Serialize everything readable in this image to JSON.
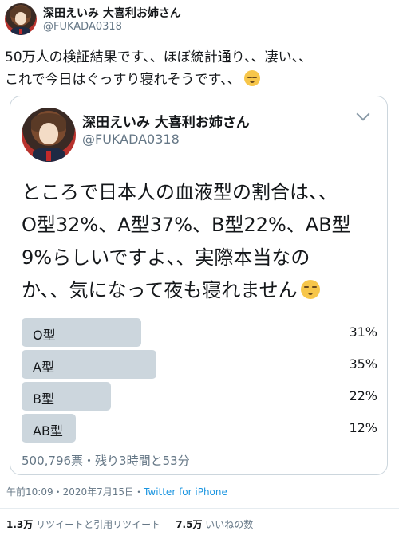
{
  "tweet": {
    "display_name": "深田えいみ 大喜利お姉さん",
    "handle": "@FUKADA0318",
    "text_line1": "50万人の検証結果です、、ほぼ統計通り、、凄い、、",
    "text_line2": "これで今日はぐっすり寝れそうです、、",
    "text_emoji": "sleeping-face-emoji"
  },
  "quoted": {
    "display_name": "深田えいみ 大喜利お姉さん",
    "handle": "@FUKADA0318",
    "text_line1": "ところで日本人の血液型の割合は、、",
    "text_line2": "O型32%、A型37%、B型22%、AB型",
    "text_line3": "9%らしいですよ、、実際本当なの",
    "text_line4": "か、、気になって夜も寝れません",
    "text_emoji": "pensive-face-emoji",
    "poll": {
      "options": [
        {
          "label": "O型",
          "percent_text": "31%",
          "percent": 31
        },
        {
          "label": "A型",
          "percent_text": "35%",
          "percent": 35
        },
        {
          "label": "B型",
          "percent_text": "22%",
          "percent": 22
        },
        {
          "label": "AB型",
          "percent_text": "12%",
          "percent": 12
        }
      ],
      "summary": "500,796票・残り3時間と53分"
    }
  },
  "meta": {
    "time": "午前10:09・2020年7月15日・",
    "source": "Twitter for iPhone"
  },
  "stats": {
    "retweets_count": "1.3万",
    "retweets_label": "リツイートと引用リツイート",
    "likes_count": "7.5万",
    "likes_label": "いいねの数"
  }
}
